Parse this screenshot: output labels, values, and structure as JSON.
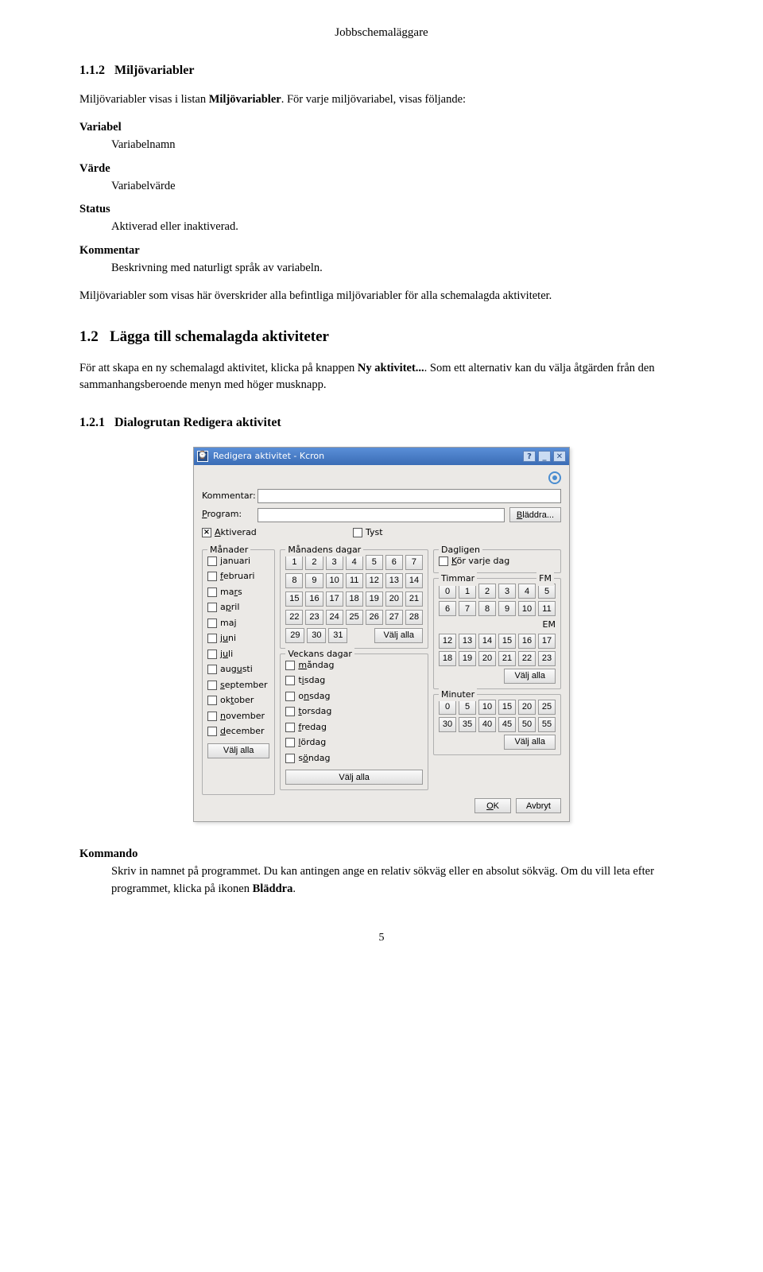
{
  "doc": {
    "header": "Jobbschemaläggare",
    "s112_num": "1.1.2",
    "s112_title": "Miljövariabler",
    "p1a": "Miljövariabler visas i listan ",
    "p1b": "Miljövariabler",
    "p1c": ". För varje miljövariabel, visas följande:",
    "dl": {
      "variabel_t": "Variabel",
      "variabel_d": "Variabelnamn",
      "varde_t": "Värde",
      "varde_d": "Variabelvärde",
      "status_t": "Status",
      "status_d": "Aktiverad eller inaktiverad.",
      "kommentar_t": "Kommentar",
      "kommentar_d": "Beskrivning med naturligt språk av variabeln."
    },
    "p2": "Miljövariabler som visas här överskrider alla befintliga miljövariabler för alla schemalagda aktiviteter.",
    "s12_num": "1.2",
    "s12_title": "Lägga till schemalagda aktiviteter",
    "p3a": "För att skapa en ny schemalagd aktivitet, klicka på knappen ",
    "p3b": "Ny aktivitet...",
    "p3c": ". Som ett alternativ kan du välja åtgärden från den sammanhangsberoende menyn med höger musknapp.",
    "s121_num": "1.2.1",
    "s121_title": "Dialogrutan Redigera aktivitet",
    "kommando_t": "Kommando",
    "kommando_a": "Skriv in namnet på programmet. Du kan antingen ange en relativ sökväg eller en absolut sökväg. Om du vill leta efter programmet, klicka på ikonen ",
    "kommando_b": "Bläddra",
    "kommando_c": ".",
    "pagenum": "5"
  },
  "dialog": {
    "title": "Redigera aktivitet - Kcron",
    "kommentar_lbl": "Kommentar:",
    "program_lbl": "Program:",
    "browse": "Bläddra...",
    "aktiverad": "Aktiverad",
    "tyst": "Tyst",
    "groups": {
      "manader": "Månader",
      "manadens_dagar": "Månadens dagar",
      "dagligen": "Dagligen",
      "timmar": "Timmar",
      "veckans_dagar": "Veckans dagar",
      "minuter": "Minuter"
    },
    "months": [
      "januari",
      "februari",
      "mars",
      "april",
      "maj",
      "juni",
      "juli",
      "augusti",
      "september",
      "oktober",
      "november",
      "december"
    ],
    "month_underline_idx": [
      0,
      0,
      2,
      1,
      2,
      1,
      1,
      3,
      0,
      2,
      0,
      0
    ],
    "days_1_7": [
      "1",
      "2",
      "3",
      "4",
      "5",
      "6",
      "7"
    ],
    "days_8_14": [
      "8",
      "9",
      "10",
      "11",
      "12",
      "13",
      "14"
    ],
    "days_15_21": [
      "15",
      "16",
      "17",
      "18",
      "19",
      "20",
      "21"
    ],
    "days_22_28": [
      "22",
      "23",
      "24",
      "25",
      "26",
      "27",
      "28"
    ],
    "days_29_31": [
      "29",
      "30",
      "31"
    ],
    "select_all": "Välj alla",
    "kor_varje_dag": "Kör varje dag",
    "fm": "FM",
    "em": "EM",
    "hours_am": [
      "0",
      "1",
      "2",
      "3",
      "4",
      "5",
      "6",
      "7",
      "8",
      "9",
      "10",
      "11"
    ],
    "hours_pm": [
      "12",
      "13",
      "14",
      "15",
      "16",
      "17",
      "18",
      "19",
      "20",
      "21",
      "22",
      "23"
    ],
    "weekdays": [
      "måndag",
      "tisdag",
      "onsdag",
      "torsdag",
      "fredag",
      "lördag",
      "söndag"
    ],
    "weekday_underline_idx": [
      0,
      1,
      1,
      0,
      0,
      0,
      1
    ],
    "minutes": [
      "0",
      "5",
      "10",
      "15",
      "20",
      "25",
      "30",
      "35",
      "40",
      "45",
      "50",
      "55"
    ],
    "ok": "OK",
    "avbryt": "Avbryt"
  }
}
